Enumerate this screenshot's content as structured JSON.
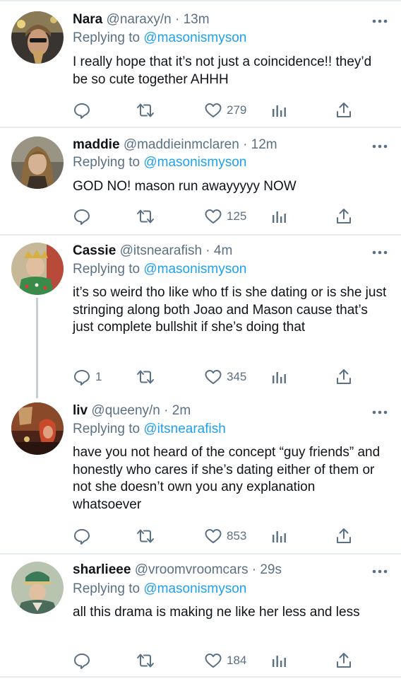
{
  "replying_prefix": "Replying to",
  "dot": "·",
  "colors": {
    "text": "#0f1419",
    "secondary": "#5b7083",
    "link": "#1da1f2",
    "divider": "#e6ecf0",
    "thread_line": "#c4cfd6"
  },
  "icons": [
    "reply-icon",
    "retweet-icon",
    "like-icon",
    "analytics-icon",
    "share-icon",
    "more-icon"
  ],
  "tweets": [
    {
      "name": "Nara",
      "handle": "@naraxy/n",
      "time": "13m",
      "replying_to": "@masonismyson",
      "text": "I really hope that it’s not just a coincidence!! they’d be so cute together AHHH",
      "replies": "",
      "retweets": "",
      "likes": "279"
    },
    {
      "name": "maddie",
      "handle": "@maddieinmclaren",
      "time": "12m",
      "replying_to": "@masonismyson",
      "text": "GOD NO! mason run awayyyyy NOW",
      "replies": "",
      "retweets": "",
      "likes": "125"
    },
    {
      "name": "Cassie",
      "handle": "@itsnearafish",
      "time": "4m",
      "replying_to": "@masonismyson",
      "text": "it’s so weird tho like who tf is she dating or is she just stringing along both Joao and Mason cause that’s just complete bullshit if she’s doing that",
      "replies": "1",
      "retweets": "",
      "likes": "345"
    },
    {
      "name": "liv",
      "handle": "@queeny/n",
      "time": "2m",
      "replying_to": "@itsnearafish",
      "text": "have you not heard of the concept “guy friends” and honestly who cares if she’s dating either of them or not she doesn’t own you any explanation whatsoever",
      "replies": "",
      "retweets": "",
      "likes": "853"
    },
    {
      "name": "sharlieee",
      "handle": "@vroomvroomcars",
      "time": "29s",
      "replying_to": "@masonismyson",
      "text": "all this drama is making ne like her less and less",
      "replies": "",
      "retweets": "",
      "likes": "184"
    }
  ]
}
